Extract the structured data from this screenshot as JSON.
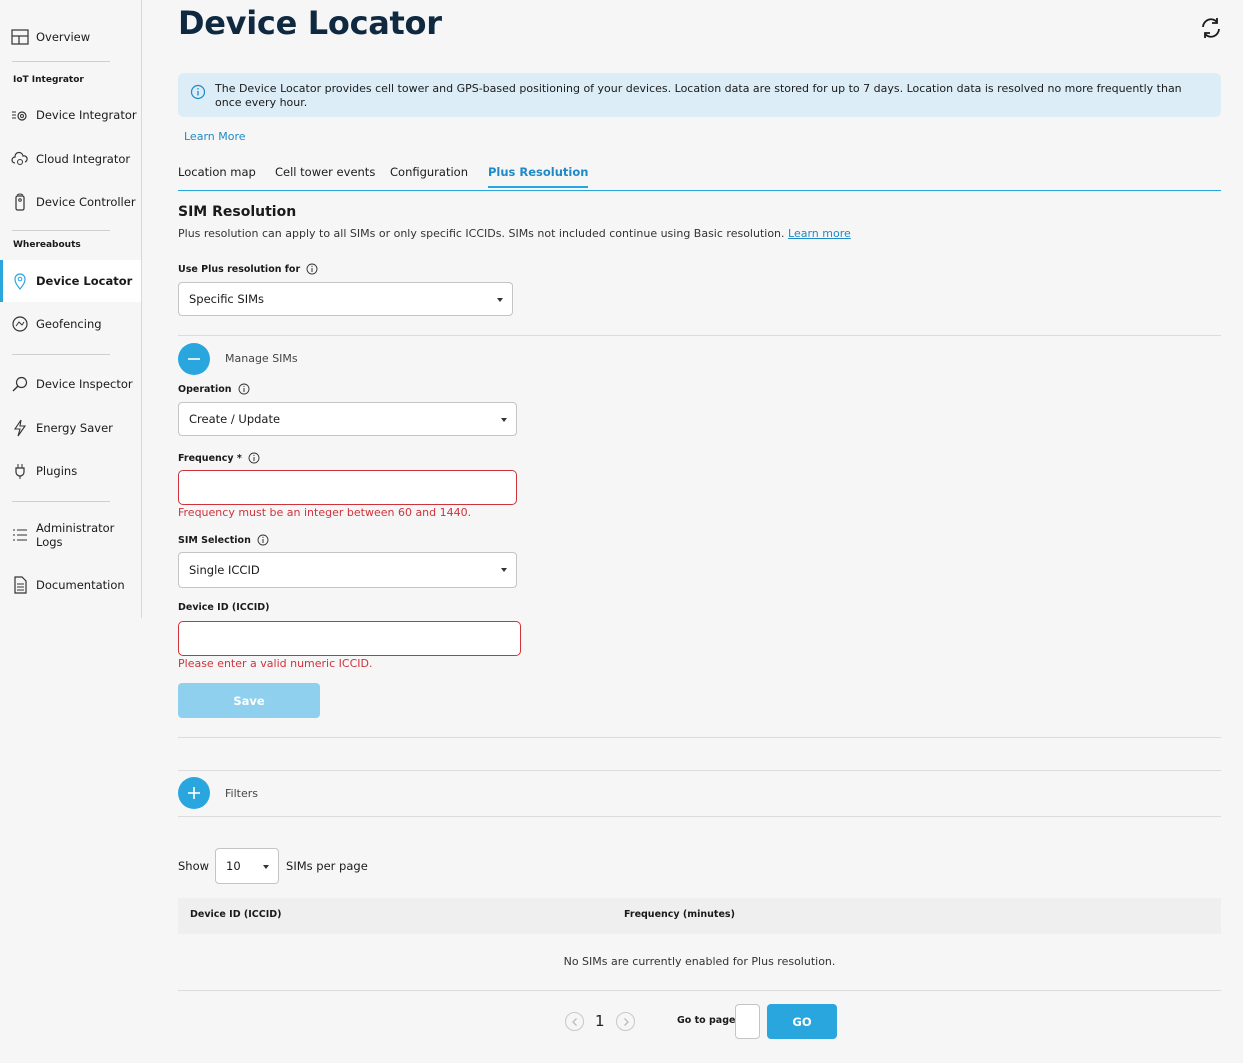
{
  "sidebar": {
    "overview": "Overview",
    "section_iot": "IoT Integrator",
    "device_integrator": "Device Integrator",
    "cloud_integrator": "Cloud Integrator",
    "device_controller": "Device Controller",
    "section_whereabouts": "Whereabouts",
    "device_locator": "Device Locator",
    "geofencing": "Geofencing",
    "device_inspector": "Device Inspector",
    "energy_saver": "Energy Saver",
    "plugins": "Plugins",
    "admin_logs_line1": "Administrator",
    "admin_logs_line2": "Logs",
    "documentation": "Documentation"
  },
  "header": {
    "title": "Device Locator"
  },
  "info": {
    "text": "The Device Locator provides cell tower and GPS-based positioning of your devices. Location data are stored for up to 7 days. Location data is resolved no more frequently than once every hour.",
    "learn_more": "Learn More"
  },
  "tabs": {
    "location_map": "Location map",
    "cell_tower_events": "Cell tower events",
    "configuration": "Configuration",
    "plus_resolution": "Plus Resolution"
  },
  "sim_resolution": {
    "title": "SIM Resolution",
    "description": "Plus resolution can apply to all SIMs or only specific ICCIDs. SIMs not included continue using Basic resolution.",
    "learn_more": "Learn more",
    "use_for_label": "Use Plus resolution for",
    "use_for_value": "Specific SIMs"
  },
  "manage": {
    "label": "Manage SIMs",
    "operation_label": "Operation",
    "operation_value": "Create / Update",
    "frequency_label": "Frequency *",
    "frequency_value": "",
    "frequency_error": "Frequency must be an integer between 60 and 1440.",
    "sim_selection_label": "SIM Selection",
    "sim_selection_value": "Single ICCID",
    "device_id_label": "Device ID (ICCID)",
    "device_id_value": "",
    "device_id_error": "Please enter a valid numeric ICCID.",
    "save_label": "Save"
  },
  "filters": {
    "label": "Filters"
  },
  "table": {
    "show_label": "Show",
    "per_page_value": "10",
    "per_page_suffix": "SIMs per page",
    "columns": [
      "Device ID (ICCID)",
      "Frequency (minutes)"
    ],
    "empty_message": "No SIMs are currently enabled for Plus resolution."
  },
  "pagination": {
    "current_page": "1",
    "goto_label": "Go to page",
    "go_label": "GO"
  },
  "colors": {
    "accent": "#2aa6df",
    "error": "#d0323c",
    "title": "#0f2a40",
    "info_bg": "#dcedf8"
  }
}
